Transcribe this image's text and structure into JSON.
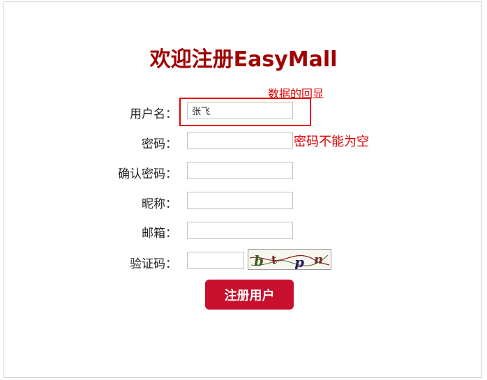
{
  "page": {
    "title": "欢迎注册EasyMall"
  },
  "annotation": {
    "text": "数据的回显"
  },
  "form": {
    "username": {
      "label": "用户名：",
      "value": "张飞"
    },
    "password": {
      "label": "密码：",
      "value": "",
      "error": "密码不能为空"
    },
    "confirm_password": {
      "label": "确认密码：",
      "value": ""
    },
    "nickname": {
      "label": "昵称：",
      "value": ""
    },
    "email": {
      "label": "邮箱：",
      "value": ""
    },
    "captcha": {
      "label": "验证码：",
      "value": "",
      "image_text": "b t p n"
    },
    "submit_label": "注册用户"
  },
  "colors": {
    "title": "#a00000",
    "annotation": "#e00000",
    "button": "#c8102e"
  }
}
